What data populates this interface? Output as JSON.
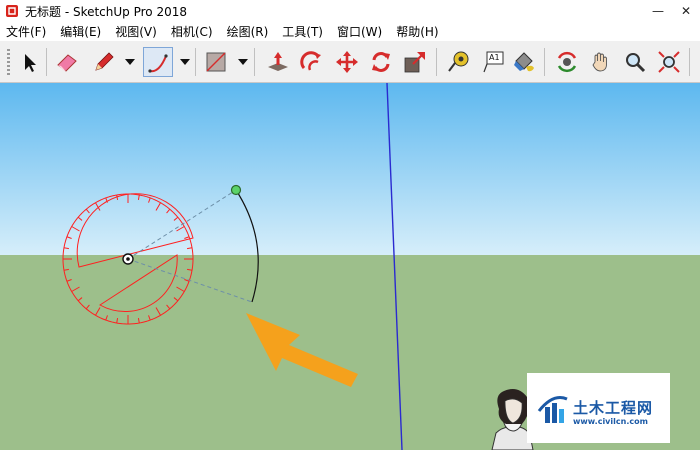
{
  "window": {
    "title": "无标题 - SketchUp Pro 2018",
    "minimize_glyph": "—",
    "close_glyph": "✕"
  },
  "menu": [
    {
      "label": "文件(F)"
    },
    {
      "label": "编辑(E)"
    },
    {
      "label": "视图(V)"
    },
    {
      "label": "相机(C)"
    },
    {
      "label": "绘图(R)"
    },
    {
      "label": "工具(T)"
    },
    {
      "label": "窗口(W)"
    },
    {
      "label": "帮助(H)"
    }
  ],
  "toolbar": {
    "text_tool_label": "A1",
    "active_tool": "arc-tool",
    "tools": [
      "select-tool",
      "eraser-tool",
      "pencil-tool",
      "arc-tool",
      "rectangle-tool",
      "push-pull-tool",
      "follow-me-tool",
      "move-tool",
      "rotate-tool",
      "scale-tool",
      "tape-measure-tool",
      "text-tool",
      "paint-bucket-tool",
      "orbit-tool",
      "pan-tool",
      "zoom-tool",
      "zoom-extents-tool"
    ]
  },
  "viewport": {
    "sky_top": "#5db8ef",
    "sky_bottom": "#d6eefa",
    "ground": "#9dbf8b",
    "protractor_color": "#ff2020",
    "arrow_color": "#f5a11c",
    "axis_color": "#2a2ad0"
  },
  "watermark": {
    "main_text": "土木工程网",
    "url_text": "www.civilcn.com"
  }
}
